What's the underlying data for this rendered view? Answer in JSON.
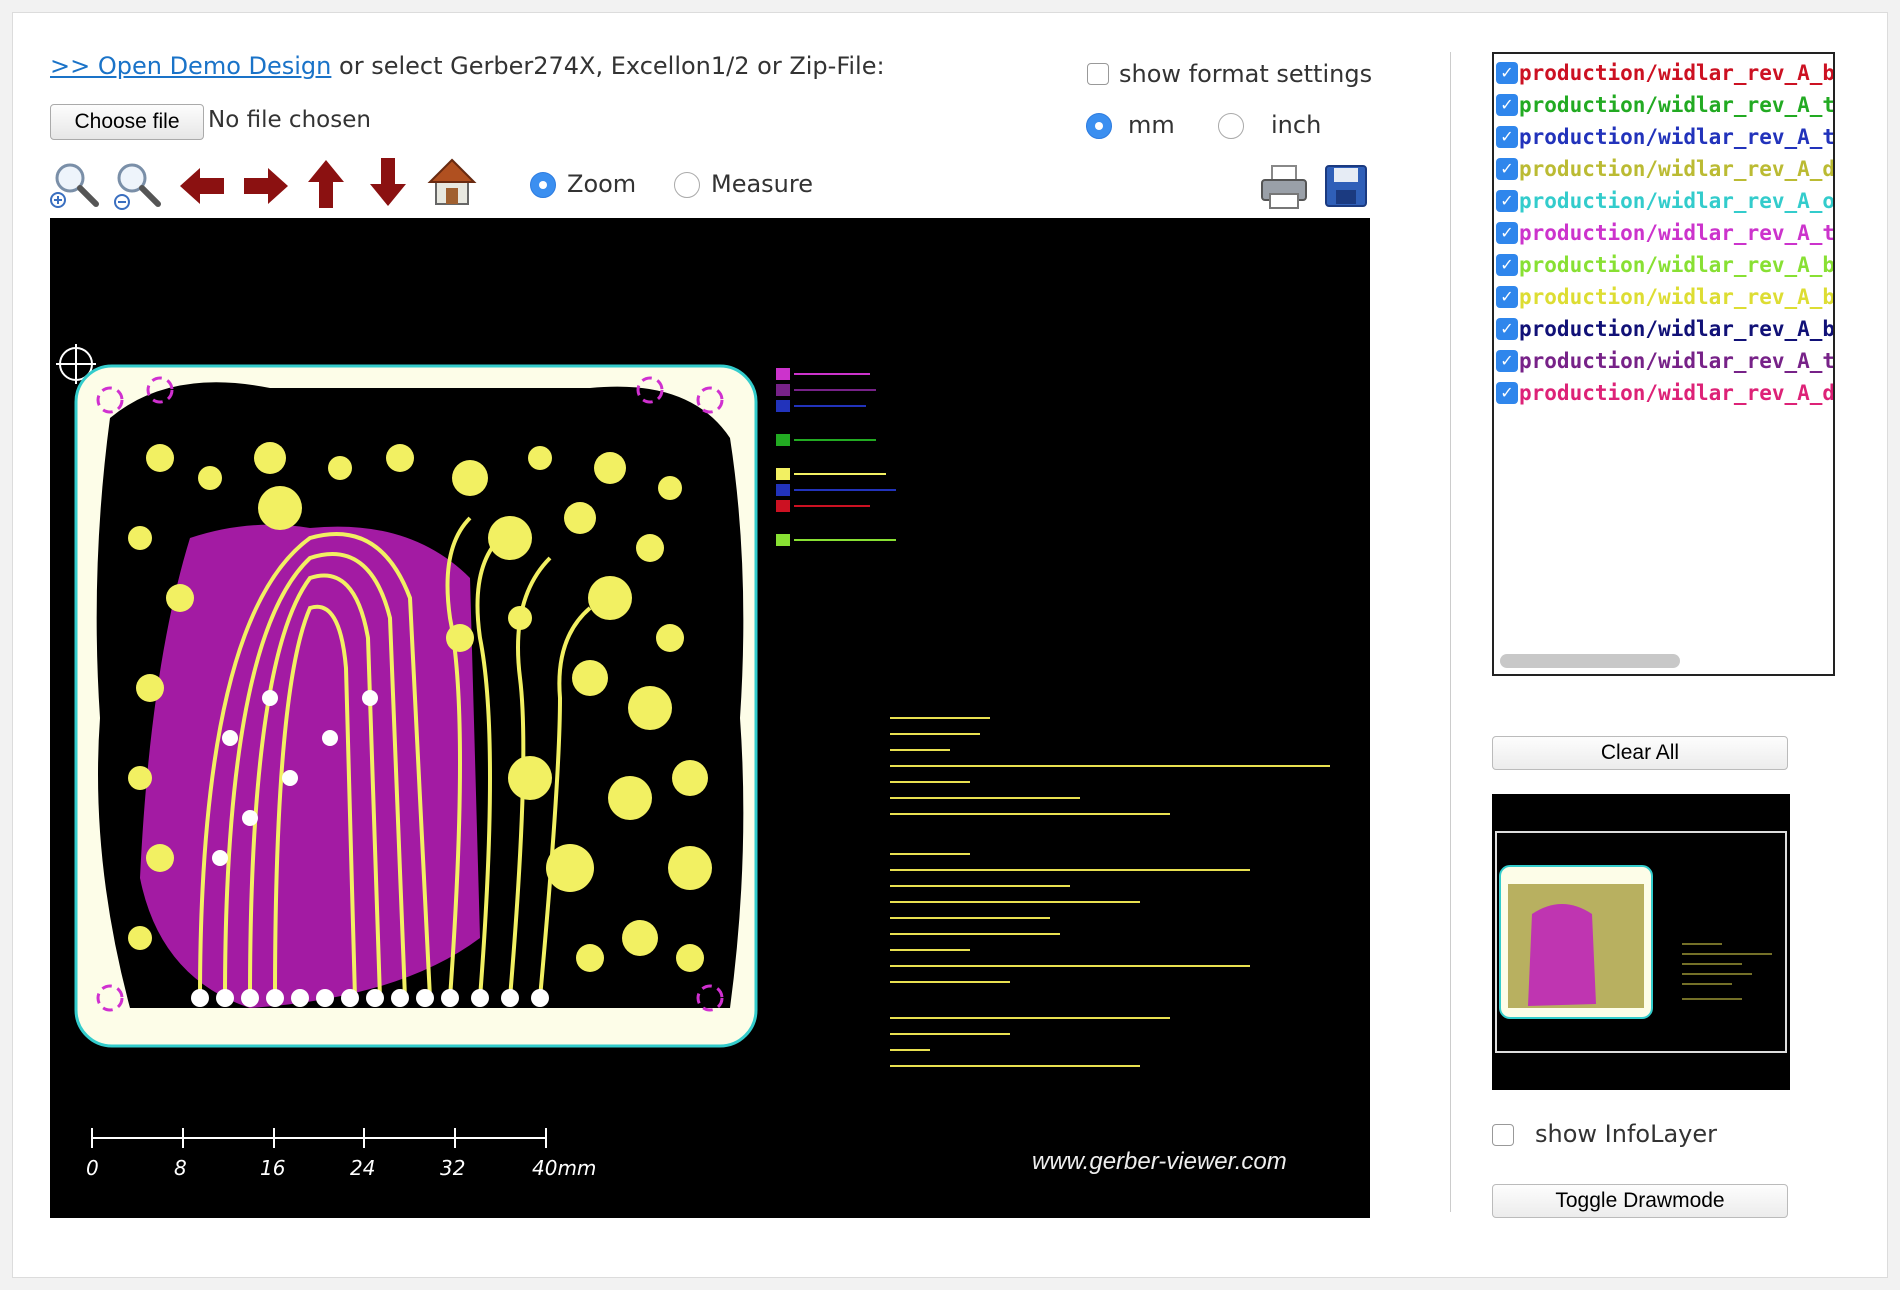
{
  "header": {
    "demo_link": ">> Open Demo Design",
    "select_text": " or select Gerber274X, Excellon1/2 or Zip-File:",
    "choose_file": "Choose file",
    "no_file": "No file chosen",
    "show_format_settings": "show format settings"
  },
  "units": {
    "mm": "mm",
    "inch": "inch",
    "selected": "mm"
  },
  "toolbar": {
    "icons": [
      "zoom-in-icon",
      "zoom-out-icon",
      "arrow-left-icon",
      "arrow-right-icon",
      "arrow-up-icon",
      "arrow-down-icon",
      "home-icon"
    ],
    "zoom": "Zoom",
    "measure": "Measure",
    "mode_selected": "Zoom"
  },
  "canvas": {
    "watermark": "www.gerber-viewer.com",
    "scale_labels": [
      "0",
      "8",
      "16",
      "24",
      "32",
      "40mm"
    ]
  },
  "layers": [
    {
      "label": "production/widlar_rev_A_bo",
      "color": "#cc1122"
    },
    {
      "label": "production/widlar_rev_A_to",
      "color": "#22aa22"
    },
    {
      "label": "production/widlar_rev_A_to",
      "color": "#2233bb"
    },
    {
      "label": "production/widlar_rev_A_dr",
      "color": "#bbbb33"
    },
    {
      "label": "production/widlar_rev_A_ou",
      "color": "#33cccc"
    },
    {
      "label": "production/widlar_rev_A_to",
      "color": "#cc33cc"
    },
    {
      "label": "production/widlar_rev_A_bo",
      "color": "#88e033"
    },
    {
      "label": "production/widlar_rev_A_bo",
      "color": "#dddd33"
    },
    {
      "label": "production/widlar_rev_A_bo",
      "color": "#111177"
    },
    {
      "label": "production/widlar_rev_A_to",
      "color": "#772288"
    },
    {
      "label": "production/widlar_rev_A_dr",
      "color": "#dd2277"
    }
  ],
  "buttons": {
    "clear_all": "Clear All",
    "toggle_drawmode": "Toggle Drawmode"
  },
  "info_layer": "show InfoLayer"
}
